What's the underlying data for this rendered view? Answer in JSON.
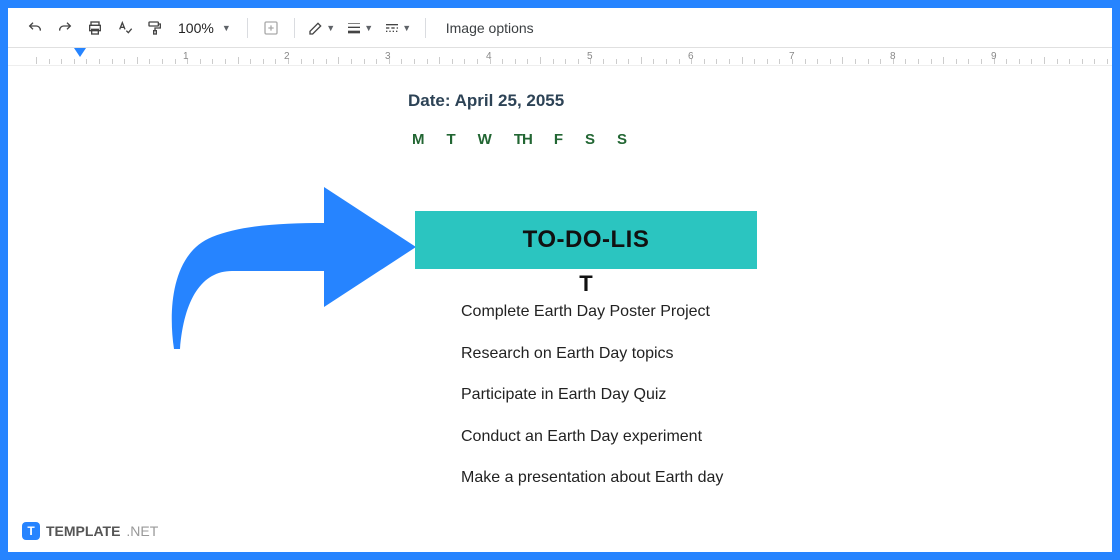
{
  "toolbar": {
    "zoom": "100%",
    "image_options": "Image options"
  },
  "ruler": {
    "marks": [
      "1",
      "2",
      "3",
      "4",
      "5",
      "6",
      "7",
      "8",
      "9"
    ]
  },
  "doc": {
    "date_label": "Date: April 25, 2055",
    "days": [
      "M",
      "T",
      "W",
      "TH",
      "F",
      "S",
      "S"
    ],
    "todo_title": "TO-DO-LIS",
    "todo_title_overflow": "T",
    "items": [
      "Complete Earth Day Poster Project",
      "Research on Earth Day topics",
      "Participate in Earth Day Quiz",
      "Conduct an Earth Day experiment",
      "Make a presentation about Earth day"
    ]
  },
  "watermark": {
    "brand": "TEMPLATE",
    "suffix": ".NET"
  }
}
